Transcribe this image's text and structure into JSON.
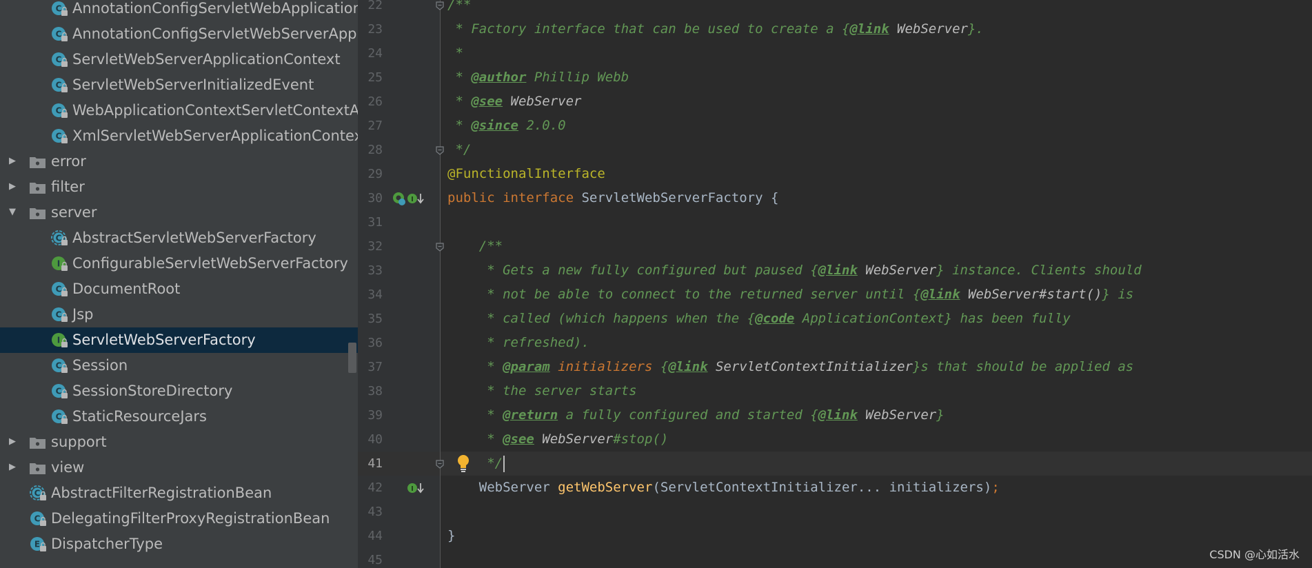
{
  "project_tree": {
    "items": [
      {
        "label": "AnnotationConfigServletWebApplicationContext",
        "type": "class",
        "indent": 2
      },
      {
        "label": "AnnotationConfigServletWebServerApplicationContext",
        "type": "class",
        "indent": 2
      },
      {
        "label": "ServletWebServerApplicationContext",
        "type": "class",
        "indent": 2
      },
      {
        "label": "ServletWebServerInitializedEvent",
        "type": "class",
        "indent": 2
      },
      {
        "label": "WebApplicationContextServletContextAwareProcessor",
        "type": "class",
        "indent": 2
      },
      {
        "label": "XmlServletWebServerApplicationContext",
        "type": "class",
        "indent": 2
      },
      {
        "label": "error",
        "type": "package",
        "indent": 1,
        "expanded": false
      },
      {
        "label": "filter",
        "type": "package",
        "indent": 1,
        "expanded": false
      },
      {
        "label": "server",
        "type": "package",
        "indent": 1,
        "expanded": true
      },
      {
        "label": "AbstractServletWebServerFactory",
        "type": "abstract-class",
        "indent": 2
      },
      {
        "label": "ConfigurableServletWebServerFactory",
        "type": "interface",
        "indent": 2
      },
      {
        "label": "DocumentRoot",
        "type": "class",
        "indent": 2
      },
      {
        "label": "Jsp",
        "type": "class",
        "indent": 2
      },
      {
        "label": "ServletWebServerFactory",
        "type": "interface",
        "indent": 2,
        "selected": true
      },
      {
        "label": "Session",
        "type": "class",
        "indent": 2
      },
      {
        "label": "SessionStoreDirectory",
        "type": "class",
        "indent": 2
      },
      {
        "label": "StaticResourceJars",
        "type": "class",
        "indent": 2
      },
      {
        "label": "support",
        "type": "package",
        "indent": 1,
        "expanded": false
      },
      {
        "label": "view",
        "type": "package",
        "indent": 1,
        "expanded": false
      },
      {
        "label": "AbstractFilterRegistrationBean",
        "type": "abstract-class",
        "indent": 1
      },
      {
        "label": "DelegatingFilterProxyRegistrationBean",
        "type": "class",
        "indent": 1
      },
      {
        "label": "DispatcherType",
        "type": "enum",
        "indent": 1
      }
    ]
  },
  "editor": {
    "current_line": 41,
    "lines": [
      {
        "num": "22",
        "tokens": [
          {
            "t": "/**",
            "c": "doc"
          }
        ]
      },
      {
        "num": "23",
        "tokens": [
          {
            "t": " * Factory interface that can be used to create a {",
            "c": "doc"
          },
          {
            "t": "@link",
            "c": "tag"
          },
          {
            "t": " WebServer",
            "c": "ref"
          },
          {
            "t": "}.",
            "c": "doc"
          }
        ]
      },
      {
        "num": "24",
        "tokens": [
          {
            "t": " *",
            "c": "doc"
          }
        ]
      },
      {
        "num": "25",
        "tokens": [
          {
            "t": " * ",
            "c": "doc"
          },
          {
            "t": "@author",
            "c": "tag"
          },
          {
            "t": " Phillip Webb",
            "c": "doc"
          }
        ]
      },
      {
        "num": "26",
        "tokens": [
          {
            "t": " * ",
            "c": "doc"
          },
          {
            "t": "@see",
            "c": "tag"
          },
          {
            "t": " WebServer",
            "c": "ref"
          }
        ]
      },
      {
        "num": "27",
        "tokens": [
          {
            "t": " * ",
            "c": "doc"
          },
          {
            "t": "@since",
            "c": "tag"
          },
          {
            "t": " 2.0.0",
            "c": "doc"
          }
        ]
      },
      {
        "num": "28",
        "tokens": [
          {
            "t": " */",
            "c": "doc"
          }
        ]
      },
      {
        "num": "29",
        "tokens": [
          {
            "t": "@FunctionalInterface",
            "c": "annot"
          }
        ]
      },
      {
        "num": "30",
        "tokens": [
          {
            "t": "public interface ",
            "c": "kw"
          },
          {
            "t": "ServletWebServerFactory {",
            "c": "plain"
          }
        ]
      },
      {
        "num": "31",
        "tokens": []
      },
      {
        "num": "32",
        "tokens": [
          {
            "t": "    /**",
            "c": "doc"
          }
        ]
      },
      {
        "num": "33",
        "tokens": [
          {
            "t": "     * Gets a new fully configured but paused {",
            "c": "doc"
          },
          {
            "t": "@link",
            "c": "tag"
          },
          {
            "t": " WebServer",
            "c": "ref"
          },
          {
            "t": "} instance. Clients should",
            "c": "doc"
          }
        ]
      },
      {
        "num": "34",
        "tokens": [
          {
            "t": "     * not be able to connect to the returned server until {",
            "c": "doc"
          },
          {
            "t": "@link",
            "c": "tag"
          },
          {
            "t": " WebServer#start()",
            "c": "ref"
          },
          {
            "t": "} is",
            "c": "doc"
          }
        ]
      },
      {
        "num": "35",
        "tokens": [
          {
            "t": "     * called (which happens when the {",
            "c": "doc"
          },
          {
            "t": "@code",
            "c": "tag"
          },
          {
            "t": " ApplicationContext",
            "c": "doc"
          },
          {
            "t": "} has been fully",
            "c": "doc"
          }
        ]
      },
      {
        "num": "36",
        "tokens": [
          {
            "t": "     * refreshed).",
            "c": "doc"
          }
        ]
      },
      {
        "num": "37",
        "tokens": [
          {
            "t": "     * ",
            "c": "doc"
          },
          {
            "t": "@param",
            "c": "tag"
          },
          {
            "t": " initializers",
            "c": "param"
          },
          {
            "t": " {",
            "c": "doc"
          },
          {
            "t": "@link",
            "c": "tag"
          },
          {
            "t": " ServletContextInitializer",
            "c": "ref"
          },
          {
            "t": "}s that should be applied as",
            "c": "doc"
          }
        ]
      },
      {
        "num": "38",
        "tokens": [
          {
            "t": "     * the server starts",
            "c": "doc"
          }
        ]
      },
      {
        "num": "39",
        "tokens": [
          {
            "t": "     * ",
            "c": "doc"
          },
          {
            "t": "@return",
            "c": "tag"
          },
          {
            "t": " a fully configured and started {",
            "c": "doc"
          },
          {
            "t": "@link",
            "c": "tag"
          },
          {
            "t": " WebServer",
            "c": "ref"
          },
          {
            "t": "}",
            "c": "doc"
          }
        ]
      },
      {
        "num": "40",
        "tokens": [
          {
            "t": "     * ",
            "c": "doc"
          },
          {
            "t": "@see",
            "c": "tag"
          },
          {
            "t": " WebServer",
            "c": "ref"
          },
          {
            "t": "#stop()",
            "c": "doc"
          }
        ]
      },
      {
        "num": "41",
        "tokens": [
          {
            "t": "     */",
            "c": "doc"
          }
        ],
        "caret": true
      },
      {
        "num": "42",
        "tokens": [
          {
            "t": "    WebServer ",
            "c": "plain"
          },
          {
            "t": "getWebServer",
            "c": "fn"
          },
          {
            "t": "(ServletContextInitializer... initializers)",
            "c": "plain"
          },
          {
            "t": ";",
            "c": "semi"
          }
        ]
      },
      {
        "num": "43",
        "tokens": []
      },
      {
        "num": "44",
        "tokens": [
          {
            "t": "}",
            "c": "plain"
          }
        ]
      },
      {
        "num": "45",
        "tokens": []
      }
    ],
    "gutter_icons": [
      {
        "line": "30",
        "icons": [
          "implemented-by-icon",
          "interface-implementations-icon",
          "navigate-down-icon"
        ]
      },
      {
        "line": "41",
        "icons": [
          "intention-bulb-icon"
        ]
      },
      {
        "line": "42",
        "icons": [
          "implemented-method-icon",
          "navigate-down-icon"
        ]
      }
    ],
    "fold_lines": [
      "22",
      "28",
      "32",
      "41"
    ]
  },
  "watermark": "CSDN @心如活水",
  "colors": {
    "tree_bg": "#3c3f41",
    "tree_selection": "#0d293e",
    "editor_bg": "#2b2b2b",
    "gutter_bg": "#313335",
    "class_icon": "#3f9bb7",
    "interface_icon": "#4e9a3e",
    "enum_icon": "#3f9bb7",
    "doc_comment": "#629755",
    "keyword": "#cc7832",
    "annotation": "#bbb529",
    "method_name": "#ffc66d"
  }
}
